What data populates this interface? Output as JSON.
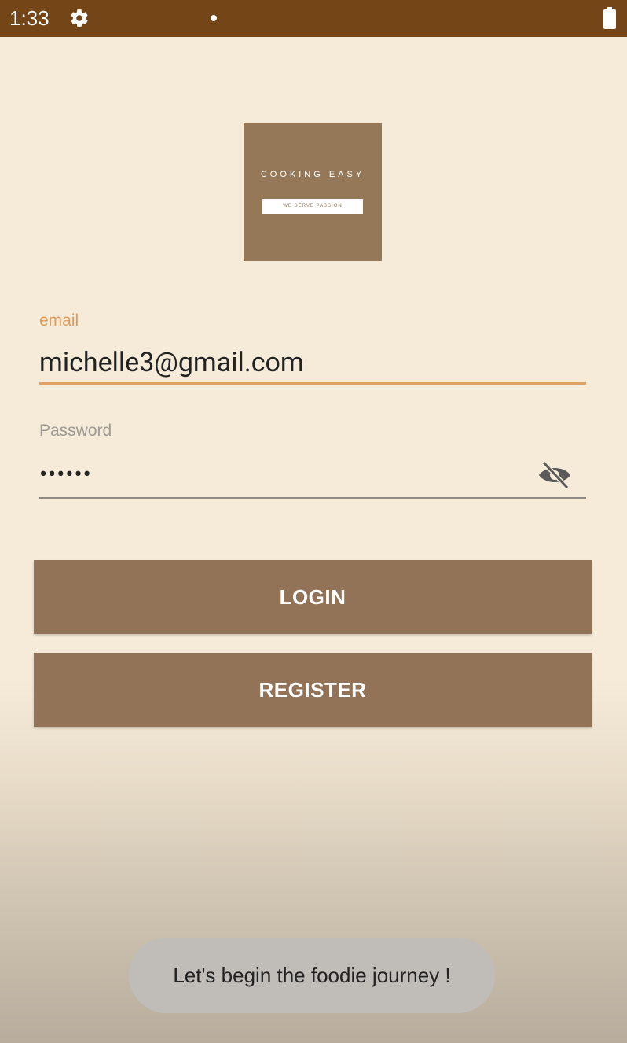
{
  "status_bar": {
    "time": "1:33",
    "icons": [
      "gear-icon",
      "notification-dot",
      "battery-icon"
    ],
    "color": "#734517"
  },
  "logo": {
    "title": "COOKING EASY",
    "tagline": "WE SERVE PASSION",
    "color": "#957858"
  },
  "email": {
    "label": "email",
    "value": "michelle3@gmail.com"
  },
  "password": {
    "label": "Password",
    "masked_value": "••••••",
    "toggle_icon": "eye-off-icon"
  },
  "buttons": {
    "login": "LOGIN",
    "register": "REGISTER",
    "color": "#937357"
  },
  "toast": {
    "message": "Let's begin the foodie journey !"
  }
}
